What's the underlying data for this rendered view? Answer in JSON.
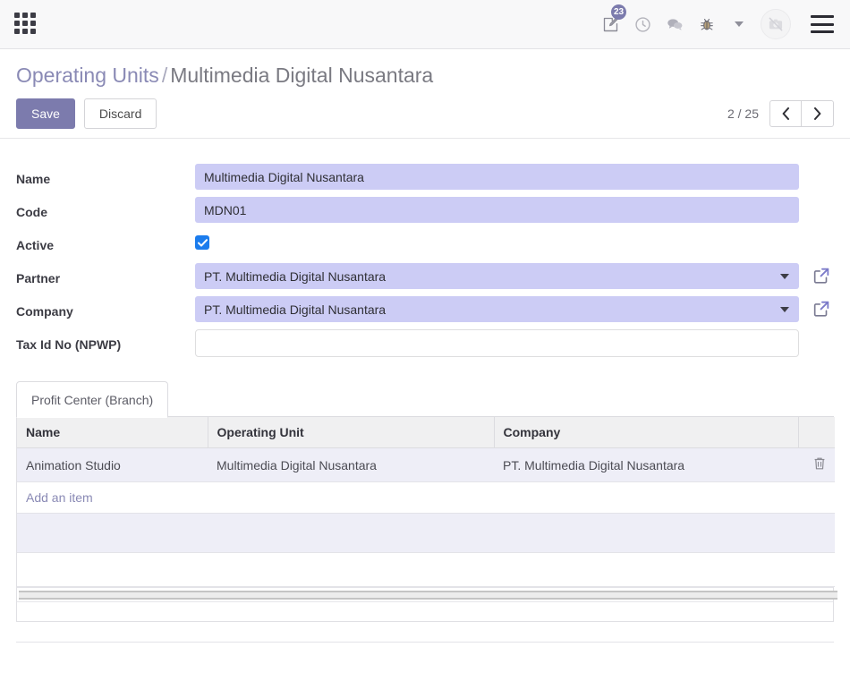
{
  "topbar": {
    "apps_icon": "apps-grid-icon",
    "items": [
      {
        "icon": "note-edit-icon",
        "badge": "23"
      },
      {
        "icon": "clock-icon",
        "badge": ""
      },
      {
        "icon": "chat-bubble-icon",
        "badge": ""
      },
      {
        "icon": "bug-icon",
        "badge": ""
      },
      {
        "icon": "chevron-down-icon",
        "badge": ""
      }
    ],
    "avatar_icon": "camera-off-icon",
    "menu_icon": "hamburger-menu-icon"
  },
  "control_panel": {
    "breadcrumb_root": "Operating Units",
    "breadcrumb_separator": "/",
    "breadcrumb_current": "Multimedia Digital Nusantara",
    "save_label": "Save",
    "discard_label": "Discard",
    "pager_value": "2 / 25",
    "pager_prev_icon": "chevron-left-icon",
    "pager_next_icon": "chevron-right-icon"
  },
  "form": {
    "fields": [
      {
        "label": "Name",
        "value": "Multimedia Digital Nusantara",
        "type": "text",
        "placeholder": ""
      },
      {
        "label": "Code",
        "value": "MDN01",
        "type": "text",
        "placeholder": ""
      },
      {
        "label": "Active",
        "value": "",
        "type": "checkbox",
        "checked": true
      },
      {
        "label": "Partner",
        "value": "PT. Multimedia Digital Nusantara",
        "type": "select",
        "external_link_icon": "external-link-icon"
      },
      {
        "label": "Company",
        "value": "PT. Multimedia Digital Nusantara",
        "type": "select",
        "external_link_icon": "external-link-icon"
      },
      {
        "label": "Tax Id No (NPWP)",
        "value": "",
        "type": "text",
        "placeholder": ""
      }
    ]
  },
  "notebook": {
    "tabs": [
      {
        "label": "Profit Center (Branch)",
        "active": true
      }
    ],
    "table": {
      "columns": [
        "Name",
        "Operating Unit",
        "Company",
        ""
      ],
      "rows": [
        {
          "name": "Animation Studio",
          "operating_unit": "Multimedia Digital Nusantara",
          "company": "PT. Multimedia Digital Nusantara",
          "delete_icon": "trash-icon"
        }
      ],
      "add_item_label": "Add an item"
    }
  },
  "colors": {
    "brand_purple": "#7c7bad",
    "field_background": "#ccccf5",
    "row_background": "#eeeef7",
    "header_background": "#f0f0f1",
    "checkbox_blue": "#1b7ced",
    "link_purple": "#8a8ab5"
  }
}
